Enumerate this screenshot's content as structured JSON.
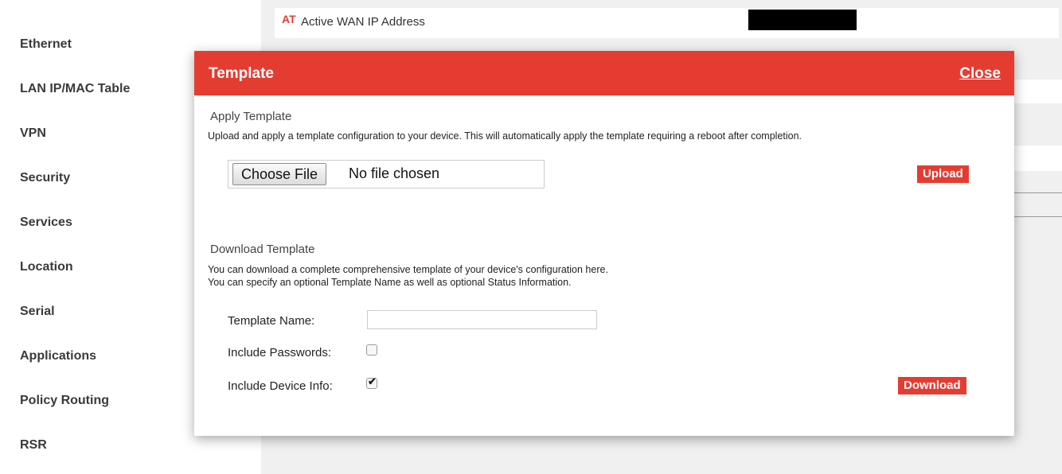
{
  "sidebar": {
    "items": [
      {
        "label": "Ethernet"
      },
      {
        "label": "LAN IP/MAC Table"
      },
      {
        "label": "VPN"
      },
      {
        "label": "Security"
      },
      {
        "label": "Services"
      },
      {
        "label": "Location"
      },
      {
        "label": "Serial"
      },
      {
        "label": "Applications"
      },
      {
        "label": "Policy Routing"
      },
      {
        "label": "RSR"
      }
    ]
  },
  "background": {
    "at_badge": "AT",
    "wan_label": "Active WAN IP Address"
  },
  "modal": {
    "title": "Template",
    "close_label": "Close",
    "apply": {
      "title": "Apply Template",
      "description": "Upload and apply a template configuration to your device. This will automatically apply the template requiring a reboot after completion.",
      "choose_file_label": "Choose File",
      "file_status": "No file chosen",
      "upload_label": "Upload"
    },
    "download": {
      "title": "Download Template",
      "description_line1": "You can download a complete comprehensive template of your device's configuration here.",
      "description_line2": "You can specify an optional Template Name as well as optional Status Information.",
      "template_name_label": "Template Name:",
      "template_name_value": "",
      "include_passwords_label": "Include Passwords:",
      "include_passwords_checked": false,
      "include_device_info_label": "Include Device Info:",
      "include_device_info_checked": true,
      "download_label": "Download"
    }
  },
  "colors": {
    "accent": "#e53c32",
    "sidebar_text": "#3a3a3a",
    "content_bg": "#f0f0f0"
  }
}
